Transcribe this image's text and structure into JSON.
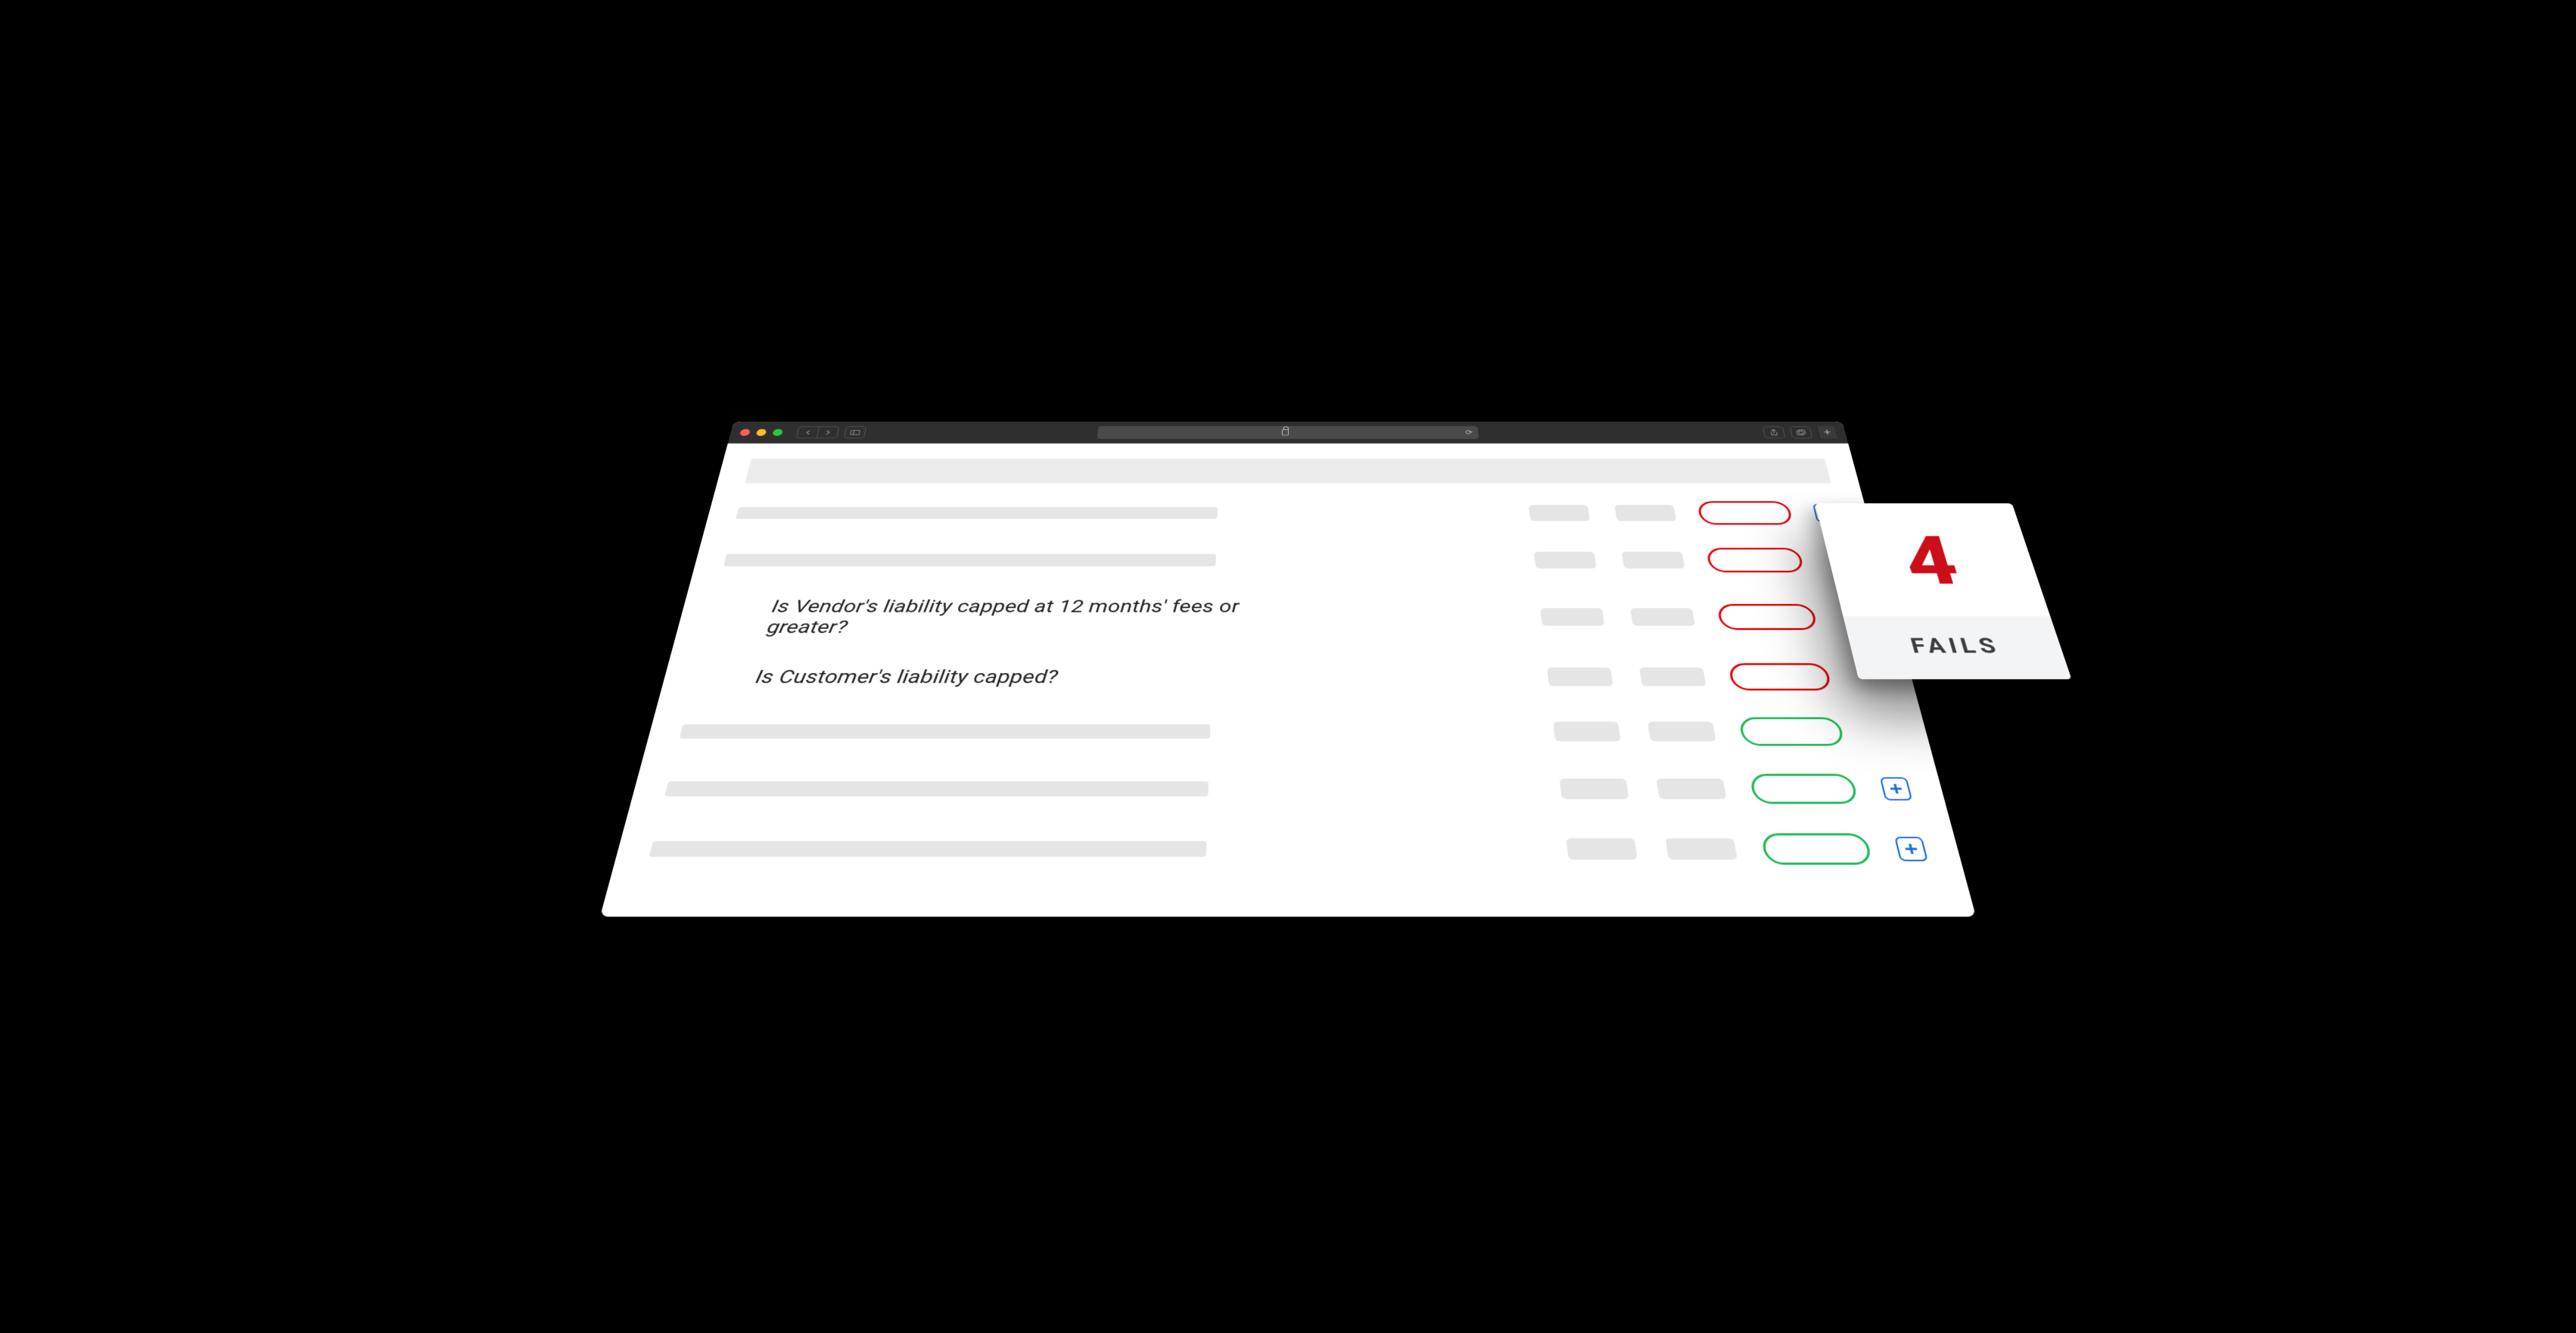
{
  "browser": {
    "url_display": ""
  },
  "header_placeholder": true,
  "rows": [
    {
      "question": null,
      "status": "fail",
      "has_add": true
    },
    {
      "question": null,
      "status": "fail",
      "has_add": false
    },
    {
      "question": "Is Vendor's liability capped at 12 months' fees or greater?",
      "status": "fail",
      "has_add": false
    },
    {
      "question": "Is Customer's liability capped?",
      "status": "fail",
      "has_add": false
    },
    {
      "question": null,
      "status": "pass",
      "has_add": false
    },
    {
      "question": null,
      "status": "pass",
      "has_add": true
    },
    {
      "question": null,
      "status": "pass",
      "has_add": true
    }
  ],
  "summary_card": {
    "count": "4",
    "label": "FAILS"
  },
  "colors": {
    "fail": "#e60000",
    "pass": "#1db954",
    "accent_blue": "#1668e3",
    "summary_red": "#cc0e1a"
  }
}
